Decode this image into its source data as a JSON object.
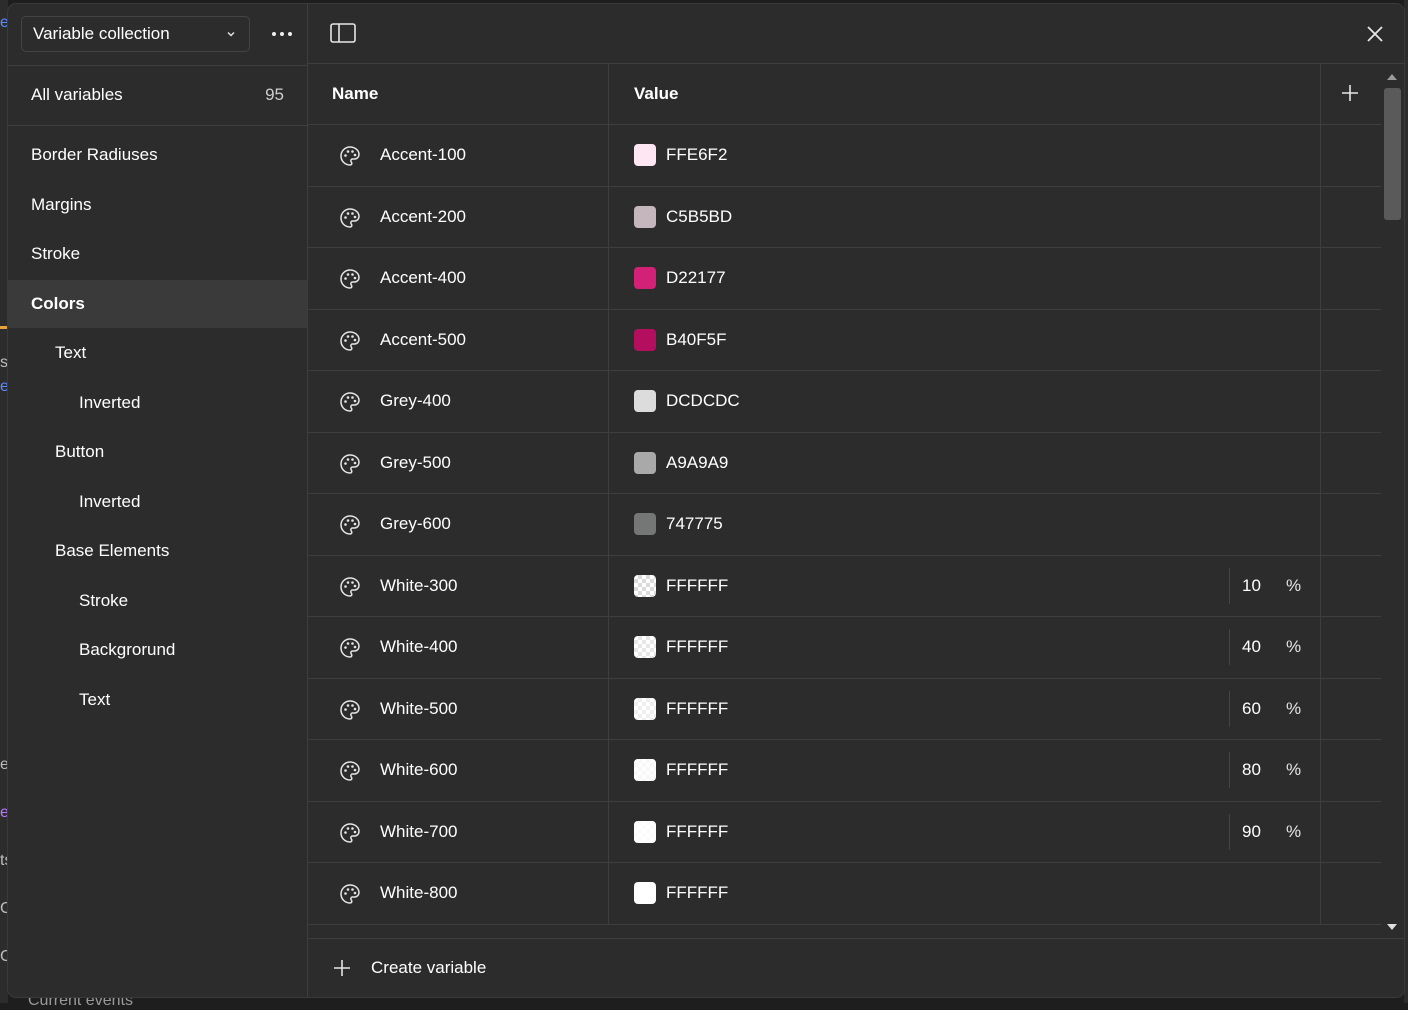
{
  "sidebar": {
    "collection_label": "Variable collection",
    "all_variables": {
      "label": "All variables",
      "count": "95"
    },
    "groups": [
      {
        "label": "Border Radiuses",
        "level": 1
      },
      {
        "label": "Margins",
        "level": 1
      },
      {
        "label": "Stroke",
        "level": 1
      },
      {
        "label": "Colors",
        "level": 1,
        "active": true
      },
      {
        "label": "Text",
        "level": 2
      },
      {
        "label": "Inverted",
        "level": 3
      },
      {
        "label": "Button",
        "level": 2
      },
      {
        "label": "Inverted",
        "level": 3
      },
      {
        "label": "Base Elements",
        "level": 2
      },
      {
        "label": "Stroke",
        "level": 3
      },
      {
        "label": "Backgrorund",
        "level": 3
      },
      {
        "label": "Text",
        "level": 3
      }
    ]
  },
  "table": {
    "columns": {
      "name": "Name",
      "value": "Value"
    },
    "rows": [
      {
        "name": "Accent-100",
        "hex": "FFE6F2",
        "color": "#FFE6F2",
        "opacity": null
      },
      {
        "name": "Accent-200",
        "hex": "C5B5BD",
        "color": "#C5B5BD",
        "opacity": null
      },
      {
        "name": "Accent-400",
        "hex": "D22177",
        "color": "#D22177",
        "opacity": null
      },
      {
        "name": "Accent-500",
        "hex": "B40F5F",
        "color": "#B40F5F",
        "opacity": null
      },
      {
        "name": "Grey-400",
        "hex": "DCDCDC",
        "color": "#DCDCDC",
        "opacity": null
      },
      {
        "name": "Grey-500",
        "hex": "A9A9A9",
        "color": "#A9A9A9",
        "opacity": null
      },
      {
        "name": "Grey-600",
        "hex": "747775",
        "color": "#747775",
        "opacity": null
      },
      {
        "name": "White-300",
        "hex": "FFFFFF",
        "color": "#FFFFFF",
        "opacity": "10"
      },
      {
        "name": "White-400",
        "hex": "FFFFFF",
        "color": "#FFFFFF",
        "opacity": "40"
      },
      {
        "name": "White-500",
        "hex": "FFFFFF",
        "color": "#FFFFFF",
        "opacity": "60"
      },
      {
        "name": "White-600",
        "hex": "FFFFFF",
        "color": "#FFFFFF",
        "opacity": "80"
      },
      {
        "name": "White-700",
        "hex": "FFFFFF",
        "color": "#FFFFFF",
        "opacity": "90"
      },
      {
        "name": "White-800",
        "hex": "FFFFFF",
        "color": "#FFFFFF",
        "opacity": null
      }
    ],
    "percent_symbol": "%"
  },
  "footer": {
    "create_label": "Create variable"
  },
  "background": {
    "glyphs": [
      "e",
      "s",
      "e",
      "er",
      "e",
      "ts",
      "C",
      "C"
    ],
    "bottom_text": "Current events"
  },
  "icons": {
    "collection_dropdown": "chevron-down-icon",
    "more": "more-horizontal-icon",
    "sidebar_toggle": "sidebar-toggle-icon",
    "close": "close-icon",
    "add": "plus-icon",
    "variable_type": "palette-icon"
  }
}
